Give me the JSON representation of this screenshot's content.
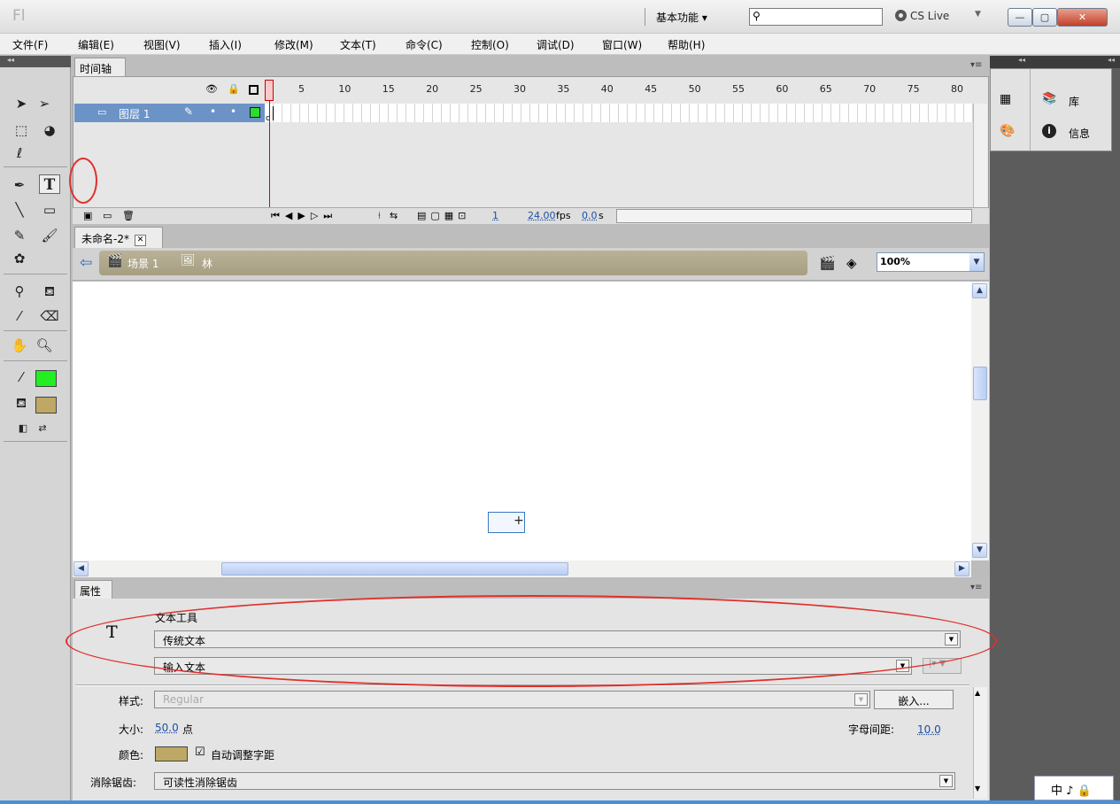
{
  "title_bar": {
    "app_logo": "Fl",
    "workspace": "基本功能 ▾",
    "search_placeholder": "",
    "cs_live": "CS Live",
    "min": "—",
    "max": "▢",
    "close": "✕"
  },
  "menu": [
    "文件(F)",
    "编辑(E)",
    "视图(V)",
    "插入(I)",
    "修改(M)",
    "文本(T)",
    "命令(C)",
    "控制(O)",
    "调试(D)",
    "窗口(W)",
    "帮助(H)"
  ],
  "timeline": {
    "tab": "时间轴",
    "layer_name": "图层 1",
    "ruler": [
      "5",
      "10",
      "15",
      "20",
      "25",
      "30",
      "35",
      "40",
      "45",
      "50",
      "55",
      "60",
      "65",
      "70",
      "75",
      "80"
    ],
    "current_frame": "1",
    "fps": "24.00",
    "fps_unit": "fps",
    "time": "0.0",
    "time_unit": "s"
  },
  "document": {
    "tab": "未命名-2*",
    "scene": "场景 1",
    "symbol": "林",
    "zoom": "100%"
  },
  "right_panel": {
    "library": "库",
    "info": "信息"
  },
  "properties": {
    "tab": "属性",
    "tool_name": "文本工具",
    "tool_icon": "T",
    "text_type": "传统文本",
    "text_subtype": "输入文本",
    "style_label": "样式:",
    "style_value": "Regular",
    "embed_button": "嵌入...",
    "size_label": "大小:",
    "size_value": "50.0",
    "size_unit": "点",
    "letter_spacing_label": "字母间距:",
    "letter_spacing_value": "10.0",
    "color_label": "颜色:",
    "auto_kern": "自动调整字距",
    "antialias_label": "消除锯齿:",
    "antialias_value": "可读性消除锯齿"
  },
  "tools": {
    "stroke_color": "#22ee22",
    "fill_color": "#bda866"
  },
  "ime": "中 ♪ 🔒"
}
